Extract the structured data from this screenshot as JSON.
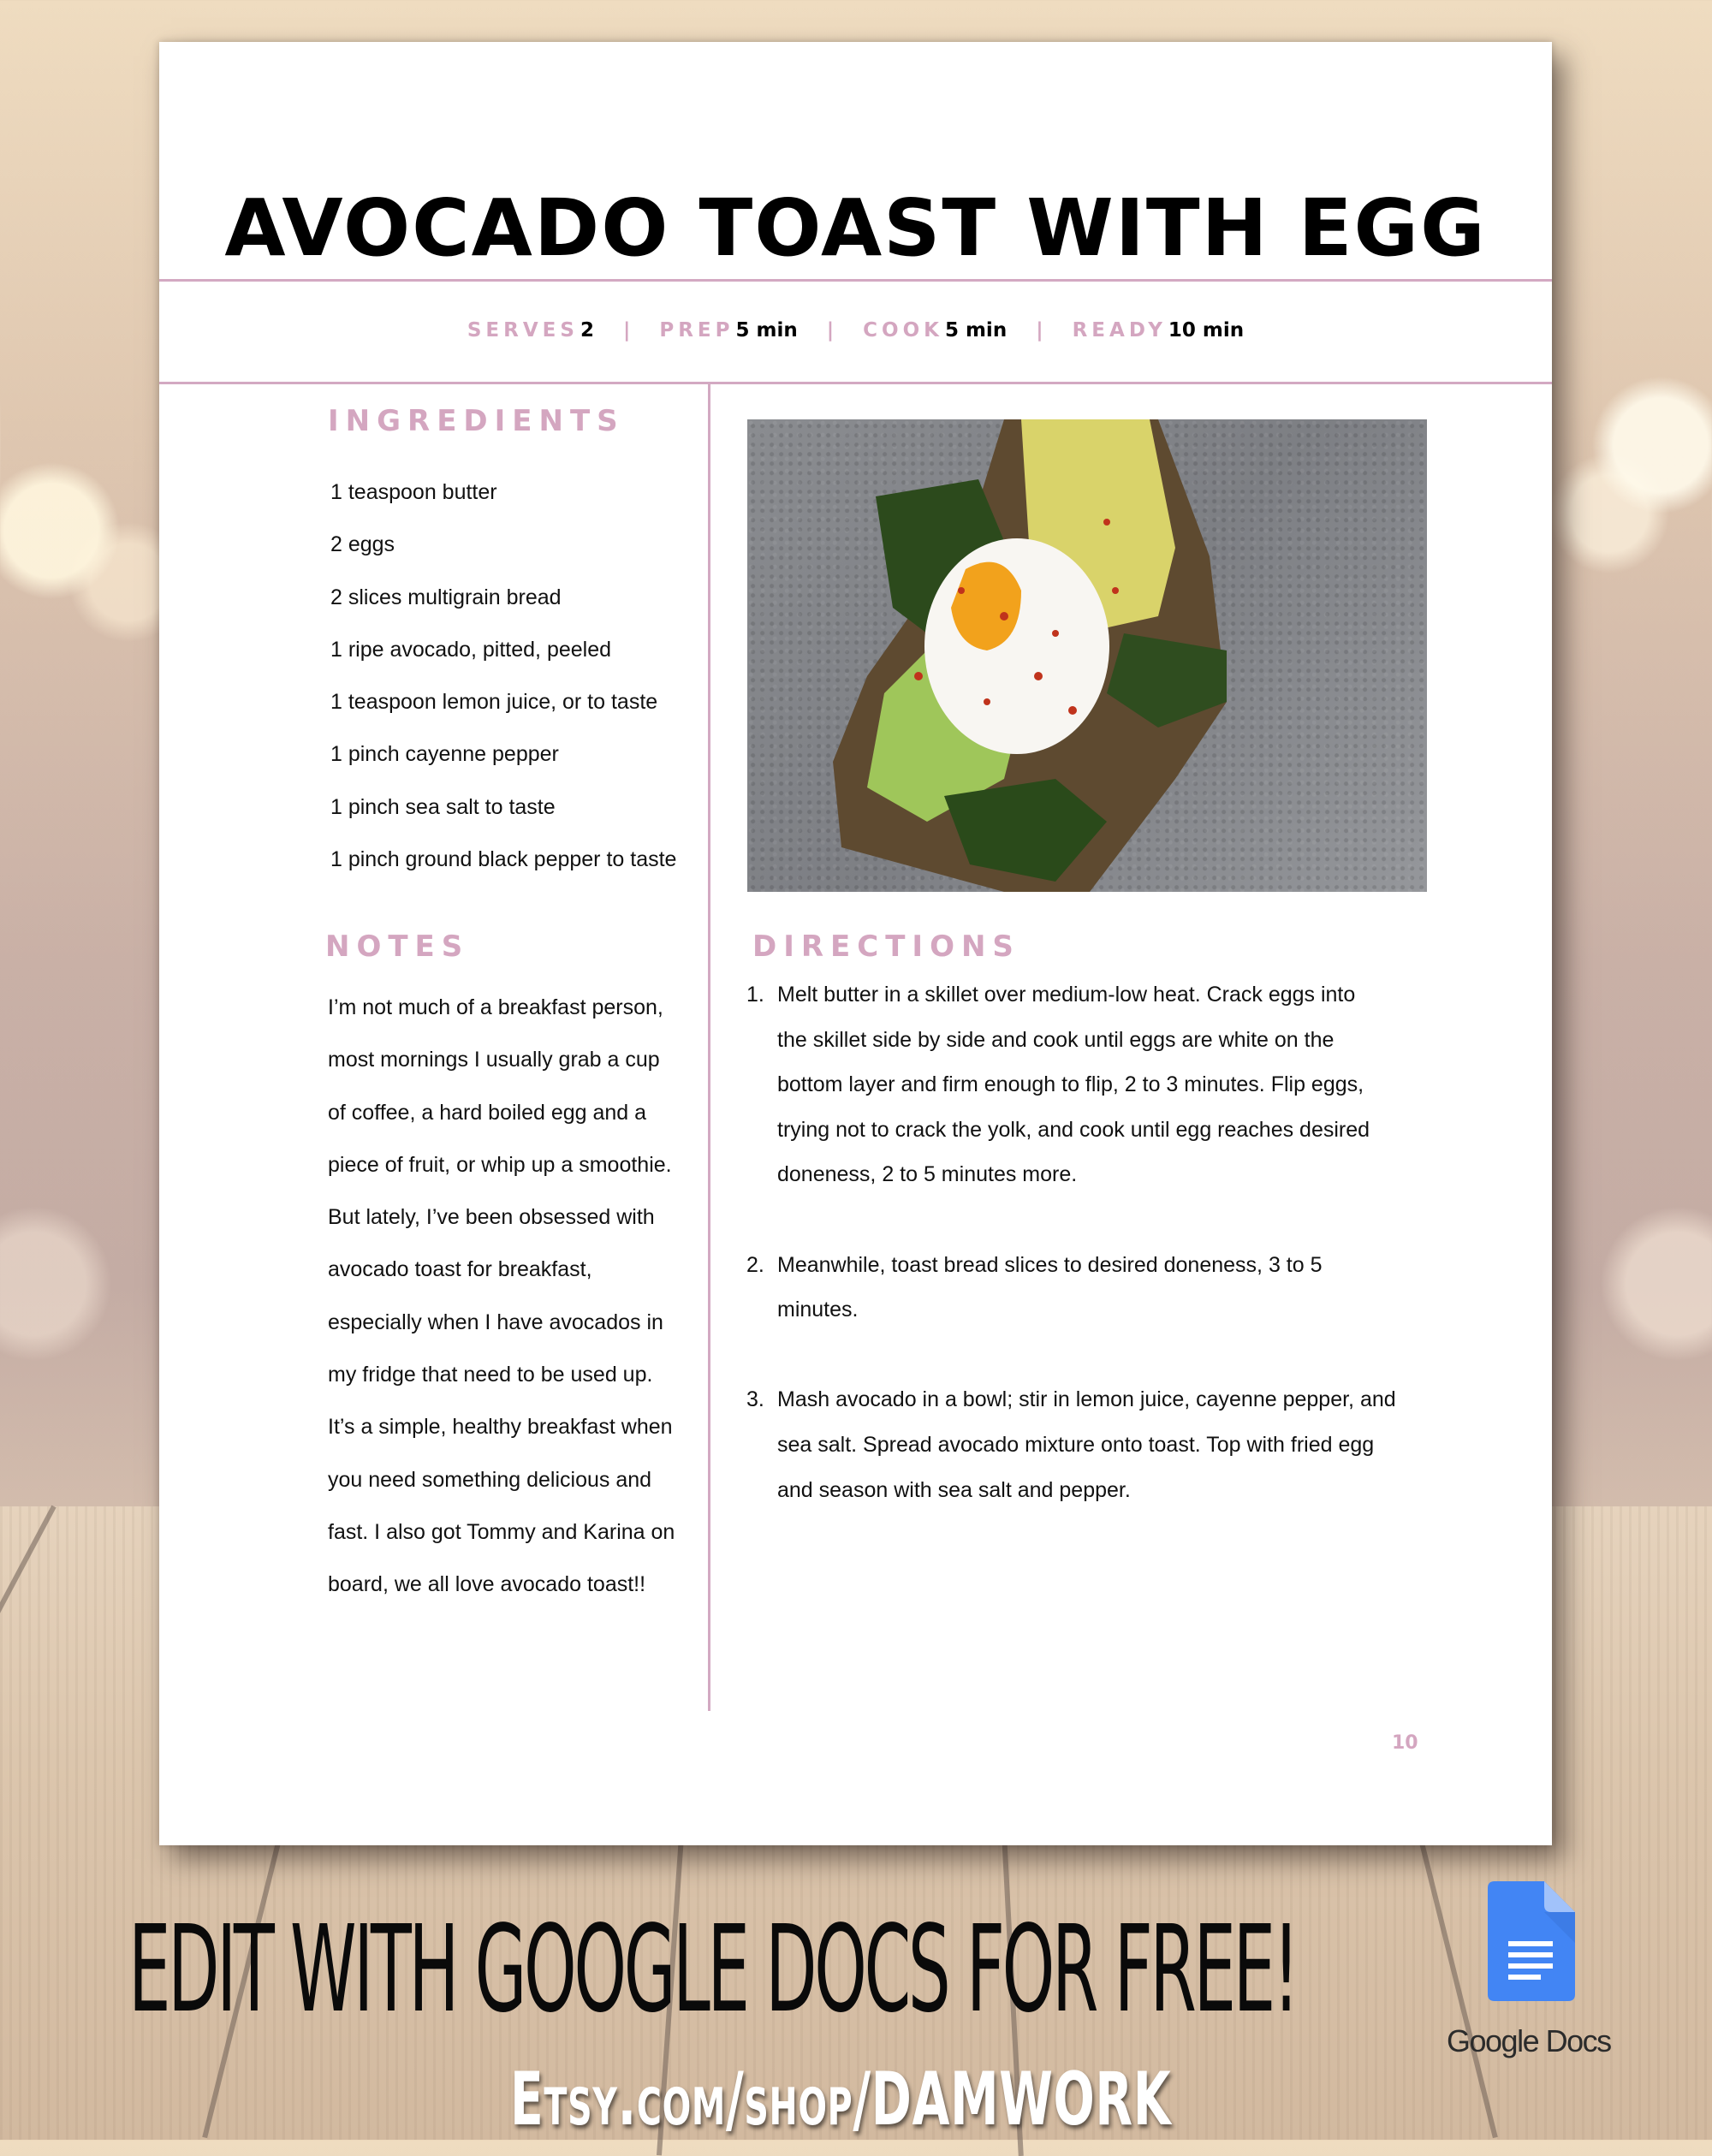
{
  "recipe": {
    "title": "AVOCADO TOAST WITH EGG",
    "meta": {
      "serves_label": "SERVES",
      "serves_value": "2",
      "prep_label": "PREP",
      "prep_value": "5 min",
      "cook_label": "COOK",
      "cook_value": "5 min",
      "ready_label": "READY",
      "ready_value": "10 min",
      "separator": "|"
    },
    "ingredients": {
      "heading": "INGREDIENTS",
      "items": [
        "1 teaspoon butter",
        "2 eggs",
        "2 slices multigrain bread",
        "1 ripe avocado, pitted, peeled",
        "1 teaspoon lemon juice, or to taste",
        "1 pinch cayenne pepper",
        "1 pinch sea salt to taste",
        "1 pinch ground black pepper to taste"
      ]
    },
    "notes": {
      "heading": "NOTES",
      "lines": [
        "I’m not much of a breakfast person,",
        "most mornings I usually grab a cup",
        "of coffee, a hard boiled egg and a",
        "piece of fruit, or whip up a smoothie.",
        "But lately, I’ve been obsessed with",
        "avocado toast for breakfast,",
        "especially when I have avocados in",
        "my fridge that need to be used up.",
        "It’s a simple, healthy breakfast when",
        "you need something delicious and",
        "fast. I also got Tommy and Karina on",
        "board, we all love avocado toast!!"
      ]
    },
    "photo": {
      "description": "poached egg on avocado toast with spinach and chili flakes"
    },
    "directions": {
      "heading": "DIRECTIONS",
      "steps": [
        {
          "num": "1.",
          "lines": [
            "Melt butter in a skillet over medium-low heat. Crack eggs into",
            "the skillet side by side and cook until eggs are white on the",
            "bottom layer and firm enough to flip, 2 to 3 minutes. Flip eggs,",
            "trying not to crack the yolk, and cook until egg reaches desired",
            "doneness, 2 to 5 minutes more."
          ]
        },
        {
          "num": "2.",
          "lines": [
            "Meanwhile, toast bread slices to desired doneness, 3 to 5",
            "minutes."
          ]
        },
        {
          "num": "3.",
          "lines": [
            "Mash avocado in a bowl; stir in lemon juice, cayenne pepper, and",
            "sea salt. Spread avocado mixture onto toast. Top with fried egg",
            "and season with sea salt and pepper."
          ]
        }
      ]
    },
    "page_number": "10"
  },
  "promo": {
    "banner": "EDIT WITH GOOGLE DOCS FOR FREE!",
    "shop_link": "Etsy.com/shop/DAMWORK",
    "app_icon": "google-docs-icon",
    "app_label": "Google Docs"
  },
  "colors": {
    "accent_pink": "#d4a6c0",
    "rule_pink": "#d3a9c2",
    "text": "#111111",
    "docs_blue": "#4285f4"
  }
}
